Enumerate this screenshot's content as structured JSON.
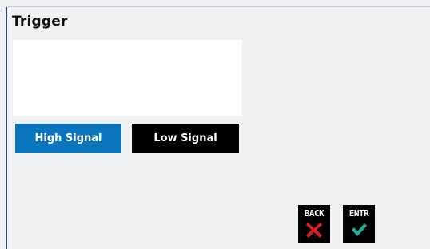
{
  "screen": {
    "title": "Trigger"
  },
  "buttons": {
    "high_signal": "High Signal",
    "low_signal": "Low Signal",
    "back": "BACK",
    "enter": "ENTR"
  },
  "icons": {
    "back": "x-icon",
    "enter": "checkmark-icon"
  },
  "colors": {
    "selected_button": "#0a74bd",
    "unselected_button": "#000000",
    "back_icon": "#e0201f",
    "enter_icon": "#17b39a"
  }
}
